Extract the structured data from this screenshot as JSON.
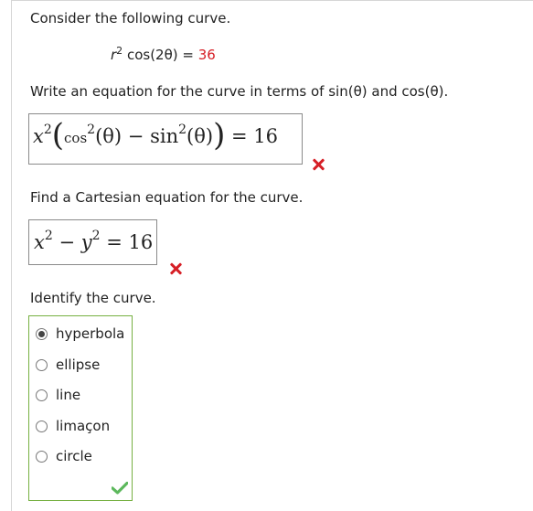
{
  "prompt": "Consider the following curve.",
  "equation": {
    "lhs": "cos(2θ)",
    "equals": " = ",
    "rhs": "36"
  },
  "q1": {
    "text": "Write an equation for the curve in terms of sin(θ) and cos(θ).",
    "answer": {
      "cos": "cos",
      "theta1": "(θ)",
      "minus": " − ",
      "sin": "sin",
      "theta2": "(θ)",
      "rhs": " = 16"
    }
  },
  "q2": {
    "text": "Find a Cartesian equation for the curve.",
    "answer": {
      "minus": " − ",
      "rhs": " = 16"
    }
  },
  "q3": {
    "text": "Identify the curve.",
    "options": [
      "hyperbola",
      "ellipse",
      "line",
      "limaçon",
      "circle"
    ],
    "selected": "hyperbola"
  },
  "colors": {
    "wrong": "#d61f26",
    "correct": "#5cb85c",
    "correct_border": "#76b041"
  },
  "icons": {
    "wrong": "x-mark-icon",
    "correct": "check-mark-icon"
  }
}
